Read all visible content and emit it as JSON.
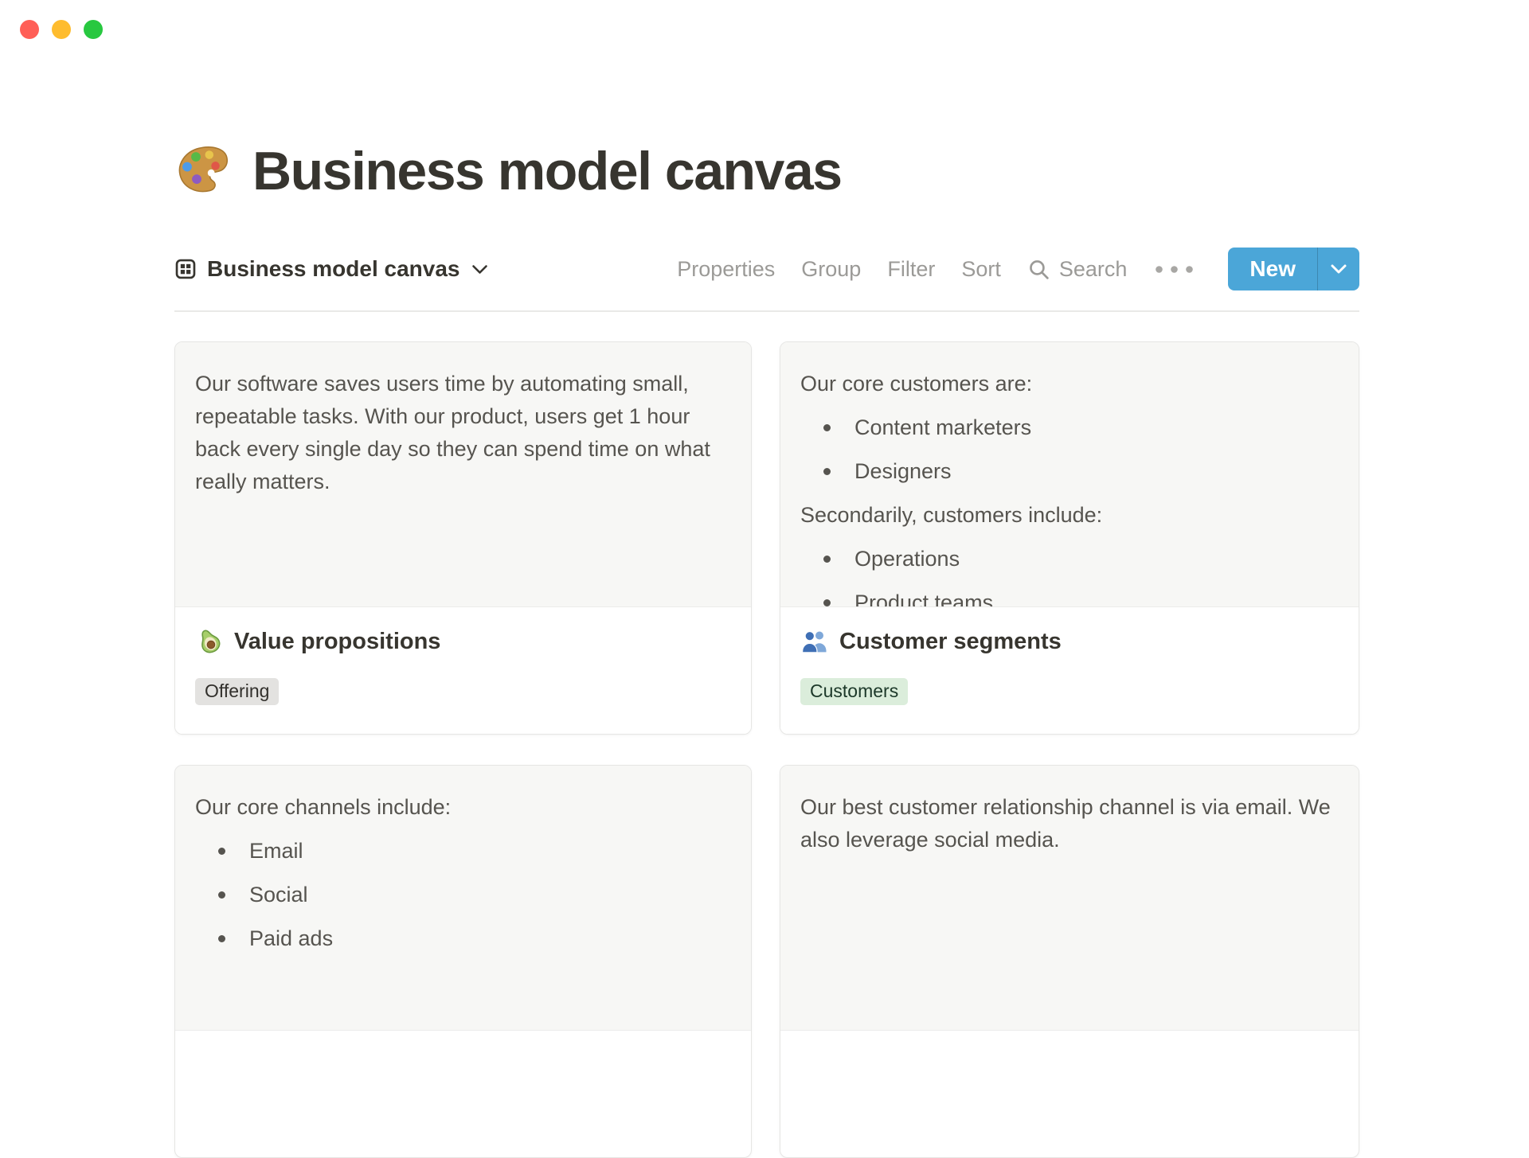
{
  "window_controls": {
    "close_color": "#ff5f57",
    "minimize_color": "#febc2e",
    "zoom_color": "#28c840"
  },
  "page": {
    "icon": "palette-emoji",
    "icon_char": "🎨",
    "title": "Business model canvas"
  },
  "view_bar": {
    "view": {
      "icon": "gallery-view-icon",
      "name": "Business model canvas"
    },
    "menu": [
      "Properties",
      "Group",
      "Filter",
      "Sort"
    ],
    "search": {
      "icon": "search-icon",
      "label": "Search"
    },
    "more_icon": "ellipsis-icon",
    "new_button": {
      "label": "New",
      "color": "#4ba6d8",
      "chevron": "chevron-down-icon"
    }
  },
  "cards": [
    {
      "name": "value-propositions",
      "preview": {
        "p1": "Our software saves users time by automating small, repeatable tasks. With our product, users get 1 hour back every single day so they can spend time on what really matters."
      },
      "footer": {
        "icon": "avocado-emoji",
        "icon_char": "🥑",
        "title": "Value propositions",
        "tag": "Offering",
        "tag_color": "gray"
      }
    },
    {
      "name": "customer-segments",
      "preview": {
        "p1": "Our core customers are:",
        "list1": [
          "Content marketers",
          "Designers"
        ],
        "p2": "Secondarily, customers include:",
        "list2": [
          "Operations",
          "Product teams"
        ]
      },
      "footer": {
        "icon": "busts-in-silhouette-emoji",
        "icon_char": "👥",
        "title": "Customer segments",
        "tag": "Customers",
        "tag_color": "green"
      }
    },
    {
      "name": "channels",
      "preview": {
        "p1": "Our core channels include:",
        "list1": [
          "Email",
          "Social",
          "Paid ads"
        ]
      }
    },
    {
      "name": "customer-relationships",
      "preview": {
        "p1": "Our best customer relationship channel is via email. We also leverage social media."
      }
    }
  ],
  "colors": {
    "accent_blue": "#4ba6d8",
    "card_preview_bg": "#f7f7f5",
    "tag_gray_bg": "#e3e2e0",
    "tag_green_bg": "#dbeddb",
    "tag_green_text": "#1c3829",
    "toolbar_text": "#9b9a97",
    "text_dark": "#37352f"
  }
}
